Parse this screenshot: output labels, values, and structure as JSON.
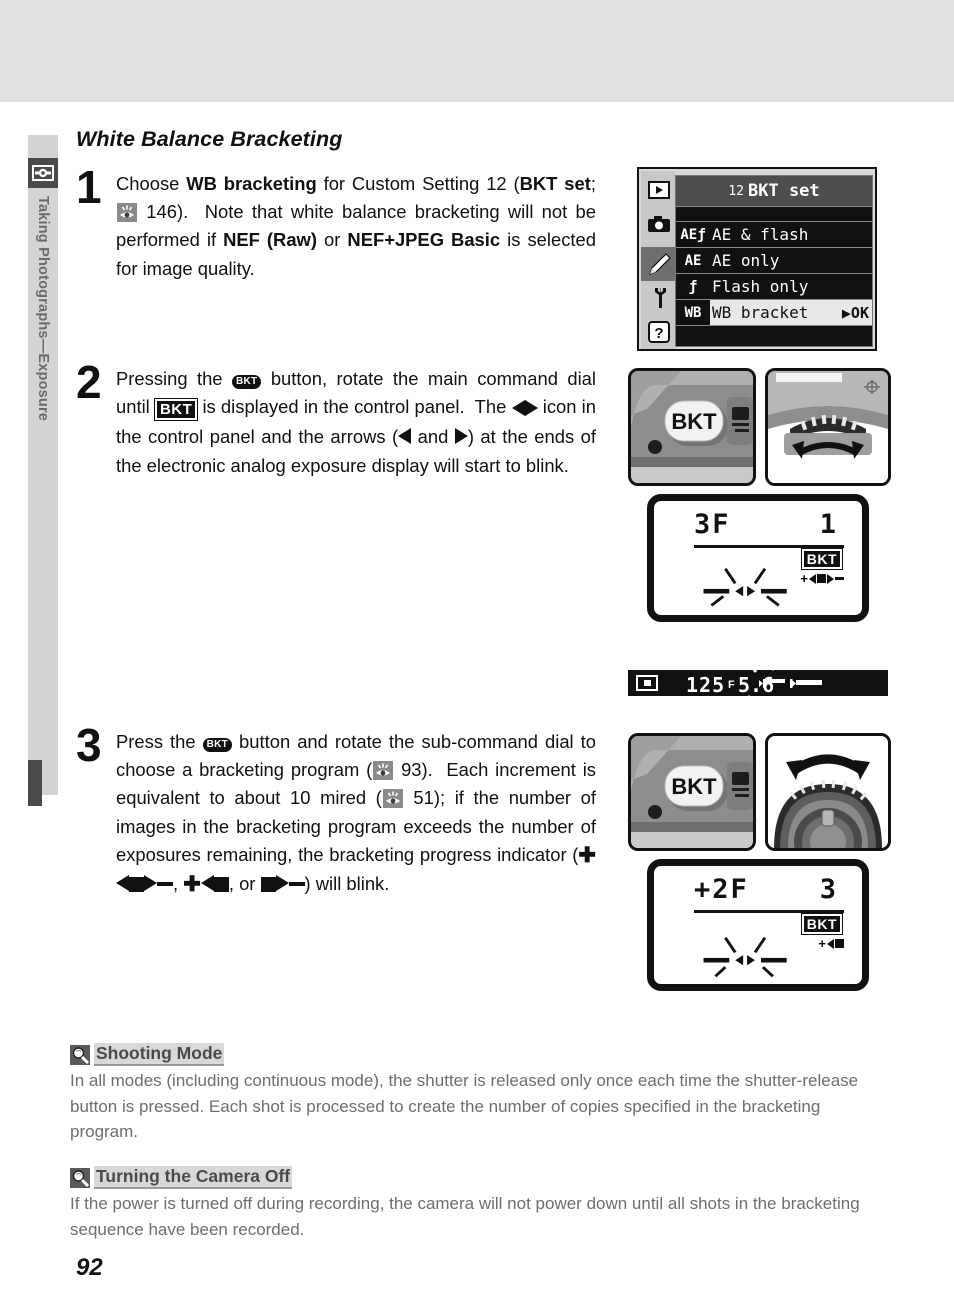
{
  "sidebar": {
    "chapter_label": "Taking Photographs—Exposure",
    "icon": "camera-exposure-icon"
  },
  "section": {
    "title": "White Balance Bracketing"
  },
  "steps": [
    {
      "number": "1",
      "text_parts": [
        {
          "t": "Choose ",
          "b": false
        },
        {
          "t": "WB bracketing",
          "b": true
        },
        {
          "t": " for Custom Setting 12 (",
          "b": false
        },
        {
          "t": "BKT set",
          "b": true
        },
        {
          "t": "; ",
          "b": false
        },
        {
          "t": "[pgref]",
          "b": false
        },
        {
          "t": " 146).  Note that white balance bracketing will not be performed if ",
          "b": false
        },
        {
          "t": "NEF (Raw)",
          "b": true
        },
        {
          "t": " or ",
          "b": false
        },
        {
          "t": "NEF+JPEG Basic",
          "b": true
        },
        {
          "t": " is selected for image quality.",
          "b": false
        }
      ]
    },
    {
      "number": "2",
      "text": "Pressing the [bkt] button, rotate the main command dial until [BKT] is displayed in the control panel.  The [◀▶] icon in the control panel and the arrows ([◀] and [▶]) at the ends of the electronic analog exposure display will start to blink."
    },
    {
      "number": "3",
      "text": "Press the [bkt] button and rotate the sub-command dial to choose a bracketing program ([pgref] 93).  Each increment is equivalent to about 10 mired ([pgref] 51); if the number of images in the bracketing program exceeds the number of exposures remaining, the bracketing progress indicator ([i1], [i2], or [i3]) will blink."
    }
  ],
  "menu_lcd": {
    "setting_number": "12",
    "title": "BKT set",
    "icons": [
      "play-icon",
      "camera-icon",
      "pencil-icon",
      "wrench-icon",
      "question-icon"
    ],
    "rows": [
      {
        "icon": "AEƒ",
        "label": "AE & flash",
        "selected": false,
        "ok": ""
      },
      {
        "icon": "AE",
        "label": "AE only",
        "selected": false,
        "ok": ""
      },
      {
        "icon": "ƒ",
        "label": "Flash only",
        "selected": false,
        "ok": ""
      },
      {
        "icon": "WB",
        "label": "WB bracket",
        "selected": true,
        "ok": "▶OK"
      }
    ]
  },
  "photos": {
    "button_label": "BKT",
    "main_dial_caption": "main-command-dial",
    "sub_dial_caption": "sub-command-dial"
  },
  "control_panel_1": {
    "main_value": "3F",
    "count_value": "1",
    "bkt_label": "BKT",
    "indicator": "+◀■▶−"
  },
  "control_panel_2": {
    "main_value": "+2F",
    "count_value": "3",
    "bkt_label": "BKT",
    "indicator": "+◀■"
  },
  "viewfinder": {
    "shutter_speed": "125",
    "aperture_prefix": "F",
    "aperture": "5.6"
  },
  "notes": [
    {
      "icon": "magnifier-icon",
      "title": "Shooting Mode",
      "body": "In all modes (including continuous mode), the shutter is released only once each time the shutter-release button is pressed.  Each shot is processed to create the number of copies specified in the bracketing program."
    },
    {
      "icon": "magnifier-icon",
      "title": "Turning the Camera Off",
      "body": "If the power is turned off during recording, the camera will not power down until all shots in the bracketing sequence have been recorded."
    }
  ],
  "page_number": "92",
  "colors": {
    "band": "#e0e0e0",
    "sidebar": "#d4d4d4",
    "sidebar_text": "#6a6a6a",
    "note_text": "#6e6e6e",
    "ink": "#111111"
  }
}
